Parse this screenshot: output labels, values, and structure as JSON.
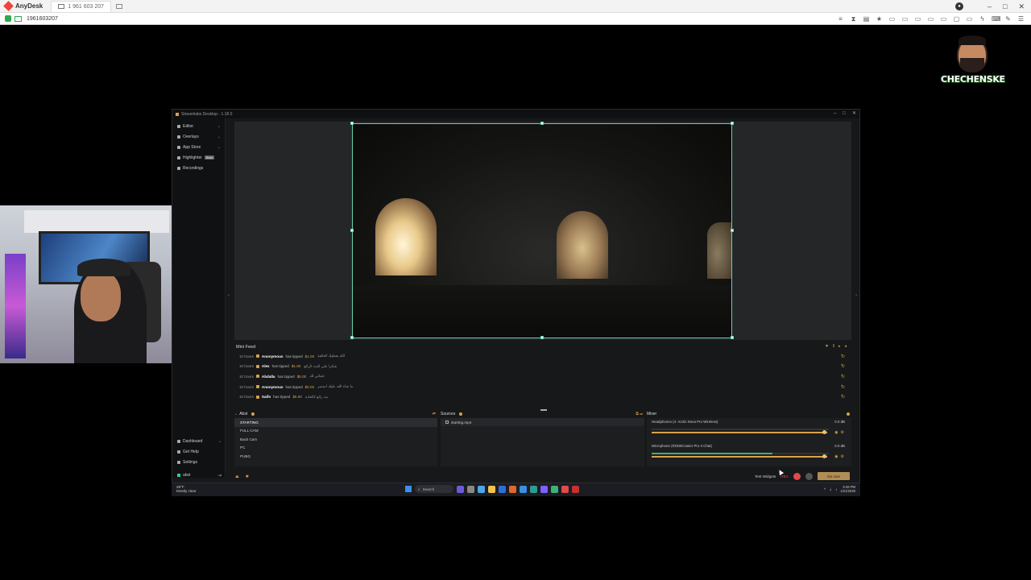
{
  "anydesk": {
    "app_name": "AnyDesk",
    "tab_label": "1 961 603 207",
    "address": "1961603207",
    "window_buttons": [
      "–",
      "□",
      "✕"
    ],
    "toolbar_icons": [
      "sliders-icon",
      "hourglass-icon",
      "database-icon",
      "star-icon",
      "monitor1-icon",
      "monitor2-icon",
      "monitor3-icon",
      "monitor4-icon",
      "monitor5-icon",
      "chat-icon",
      "display-icon",
      "bolt-icon",
      "keyboard-icon",
      "pen-icon",
      "menu-icon"
    ]
  },
  "overlay": {
    "channel_name": "CHECHENSKE"
  },
  "streamlabs": {
    "title": "Streamlabs Desktop - 1.18.0",
    "nav": [
      {
        "label": "Editor",
        "chevron": true
      },
      {
        "label": "Overlays",
        "chevron": true
      },
      {
        "label": "App Store",
        "chevron": true
      },
      {
        "label": "Highlighter",
        "badge": "Beta"
      },
      {
        "label": "Recordings"
      }
    ],
    "nav_bottom": [
      {
        "label": "Dashboard",
        "chevron": true
      },
      {
        "label": "Get Help"
      },
      {
        "label": "Settings"
      }
    ],
    "account": "abst",
    "mini_feed": {
      "title": "Mini Feed",
      "rows": [
        {
          "time": "10 hours",
          "who": "Anonymous",
          "action": "has tipped",
          "amount": "$1.00",
          "message": "الله يعطيك العافية"
        },
        {
          "time": "10 hours",
          "who": "Alex",
          "action": "has tipped",
          "amount": "$1.00",
          "message": "شكرا على البث الرائع"
        },
        {
          "time": "10 hours",
          "who": "Abdalla",
          "action": "has tipped",
          "amount": "$5.00",
          "message": "تحياتي لك"
        },
        {
          "time": "10 hours",
          "who": "Anonymous",
          "action": "has tipped",
          "amount": "$5.00",
          "message": "ما شاء الله عليك استمر"
        },
        {
          "time": "10 hours",
          "who": "Saifo",
          "action": "has tipped",
          "amount": "$5.00",
          "message": "بث رائع كالعادة"
        }
      ]
    },
    "scenes": {
      "title": "Abst",
      "items": [
        "STARTING",
        "FULL CAM",
        "Back Cam",
        "PC",
        "PUBG"
      ]
    },
    "sources": {
      "title": "Sources",
      "items": [
        "starting.mp4"
      ]
    },
    "mixer": {
      "title": "Mixer",
      "channels": [
        {
          "name": "Headphones (4- Arctis Nova Pro Wireless)",
          "db": "0.0 dB",
          "level": 0.0,
          "volume": 0.98
        },
        {
          "name": "Microphone (RODECaster Pro II Chat)",
          "db": "0.0 dB",
          "level": 0.68,
          "volume": 0.98
        }
      ]
    },
    "footer": {
      "test_widgets": "Test Widgets",
      "rec_time": "REC",
      "go_live": "Go Live"
    }
  },
  "taskbar": {
    "weather_temp": "28°F",
    "weather_desc": "Mostly clear",
    "search_placeholder": "Search",
    "time": "9:28 PM",
    "date": "1/21/2025"
  }
}
